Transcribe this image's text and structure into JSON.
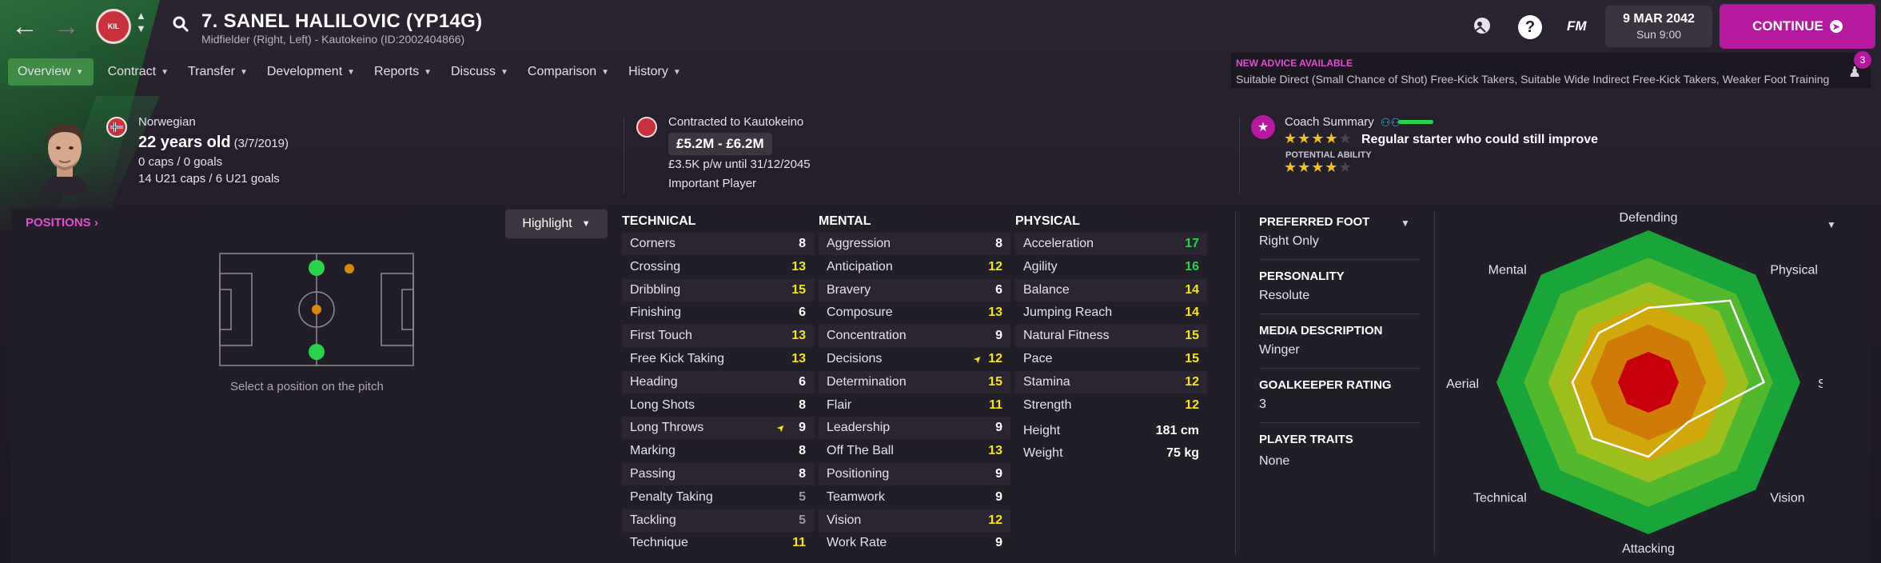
{
  "header": {
    "name": "7. SANEL HALILOVIC (YP14G)",
    "subtitle": "Midfielder (Right, Left) - Kautokeino (ID:2002404866)",
    "date": "9 MAR 2042",
    "time": "Sun 9:00",
    "fm_label": "FM",
    "continue_label": "CONTINUE",
    "club_crest_text": "KIL"
  },
  "menu": [
    {
      "label": "Overview",
      "active": true
    },
    {
      "label": "Contract"
    },
    {
      "label": "Transfer"
    },
    {
      "label": "Development"
    },
    {
      "label": "Reports"
    },
    {
      "label": "Discuss"
    },
    {
      "label": "Comparison"
    },
    {
      "label": "History"
    }
  ],
  "advice": {
    "title": "NEW ADVICE AVAILABLE",
    "text": "Suitable Direct (Small Chance of Shot) Free-Kick Takers, Suitable Wide Indirect Free-Kick Takers, Weaker Foot Training",
    "count": "3"
  },
  "player": {
    "nationality": "Norwegian",
    "age": "22 years old",
    "dob": "(3/7/2019)",
    "caps": "0 caps / 0 goals",
    "u21": "14 U21 caps / 6 U21 goals"
  },
  "contract": {
    "line1": "Contracted to Kautokeino",
    "value": "£5.2M - £6.2M",
    "wage": "£3.5K p/w until 31/12/2045",
    "status": "Important Player"
  },
  "coach": {
    "title": "Coach Summary",
    "summary": "Regular starter who could still improve",
    "potential_label": "POTENTIAL ABILITY",
    "current_stars": 3.5,
    "potential_stars": 3.5
  },
  "positions": {
    "title": "POSITIONS",
    "highlight_label": "Highlight",
    "hint": "Select a position on the pitch"
  },
  "attributes": {
    "technical_title": "TECHNICAL",
    "mental_title": "MENTAL",
    "physical_title": "PHYSICAL",
    "technical": [
      {
        "name": "Corners",
        "value": "8"
      },
      {
        "name": "Crossing",
        "value": "13"
      },
      {
        "name": "Dribbling",
        "value": "15"
      },
      {
        "name": "Finishing",
        "value": "6"
      },
      {
        "name": "First Touch",
        "value": "13"
      },
      {
        "name": "Free Kick Taking",
        "value": "13"
      },
      {
        "name": "Heading",
        "value": "6"
      },
      {
        "name": "Long Shots",
        "value": "8"
      },
      {
        "name": "Long Throws",
        "value": "9"
      },
      {
        "name": "Marking",
        "value": "8"
      },
      {
        "name": "Passing",
        "value": "8"
      },
      {
        "name": "Penalty Taking",
        "value": "5"
      },
      {
        "name": "Tackling",
        "value": "5"
      },
      {
        "name": "Technique",
        "value": "11"
      }
    ],
    "mental": [
      {
        "name": "Aggression",
        "value": "8"
      },
      {
        "name": "Anticipation",
        "value": "12"
      },
      {
        "name": "Bravery",
        "value": "6"
      },
      {
        "name": "Composure",
        "value": "13"
      },
      {
        "name": "Concentration",
        "value": "9"
      },
      {
        "name": "Decisions",
        "value": "12"
      },
      {
        "name": "Determination",
        "value": "15"
      },
      {
        "name": "Flair",
        "value": "11"
      },
      {
        "name": "Leadership",
        "value": "9"
      },
      {
        "name": "Off The Ball",
        "value": "13"
      },
      {
        "name": "Positioning",
        "value": "9"
      },
      {
        "name": "Teamwork",
        "value": "9"
      },
      {
        "name": "Vision",
        "value": "12"
      },
      {
        "name": "Work Rate",
        "value": "9"
      }
    ],
    "physical": [
      {
        "name": "Acceleration",
        "value": "17"
      },
      {
        "name": "Agility",
        "value": "16"
      },
      {
        "name": "Balance",
        "value": "14"
      },
      {
        "name": "Jumping Reach",
        "value": "14"
      },
      {
        "name": "Natural Fitness",
        "value": "15"
      },
      {
        "name": "Pace",
        "value": "15"
      },
      {
        "name": "Stamina",
        "value": "12"
      },
      {
        "name": "Strength",
        "value": "12"
      }
    ],
    "height_label": "Height",
    "height": "181 cm",
    "weight_label": "Weight",
    "weight": "75 kg"
  },
  "side": {
    "foot_title": "PREFERRED FOOT",
    "foot": "Right Only",
    "personality_title": "PERSONALITY",
    "personality": "Resolute",
    "media_title": "MEDIA DESCRIPTION",
    "media": "Winger",
    "gk_title": "GOALKEEPER RATING",
    "gk": "3",
    "traits_title": "PLAYER TRAITS",
    "traits": "None"
  },
  "radar": {
    "labels": [
      "Defending",
      "Physical",
      "Speed",
      "Vision",
      "Attacking",
      "Technical",
      "Aerial",
      "Mental"
    ],
    "values": [
      0.49,
      0.76,
      0.76,
      0.37,
      0.49,
      0.52,
      0.5,
      0.46
    ]
  },
  "colors": {
    "accent": "#b4199e",
    "green": "#3f8a44",
    "good": "#2bd34c",
    "yellow": "#f4e41c",
    "white": "#ffffff",
    "grey": "#9a95a0"
  }
}
